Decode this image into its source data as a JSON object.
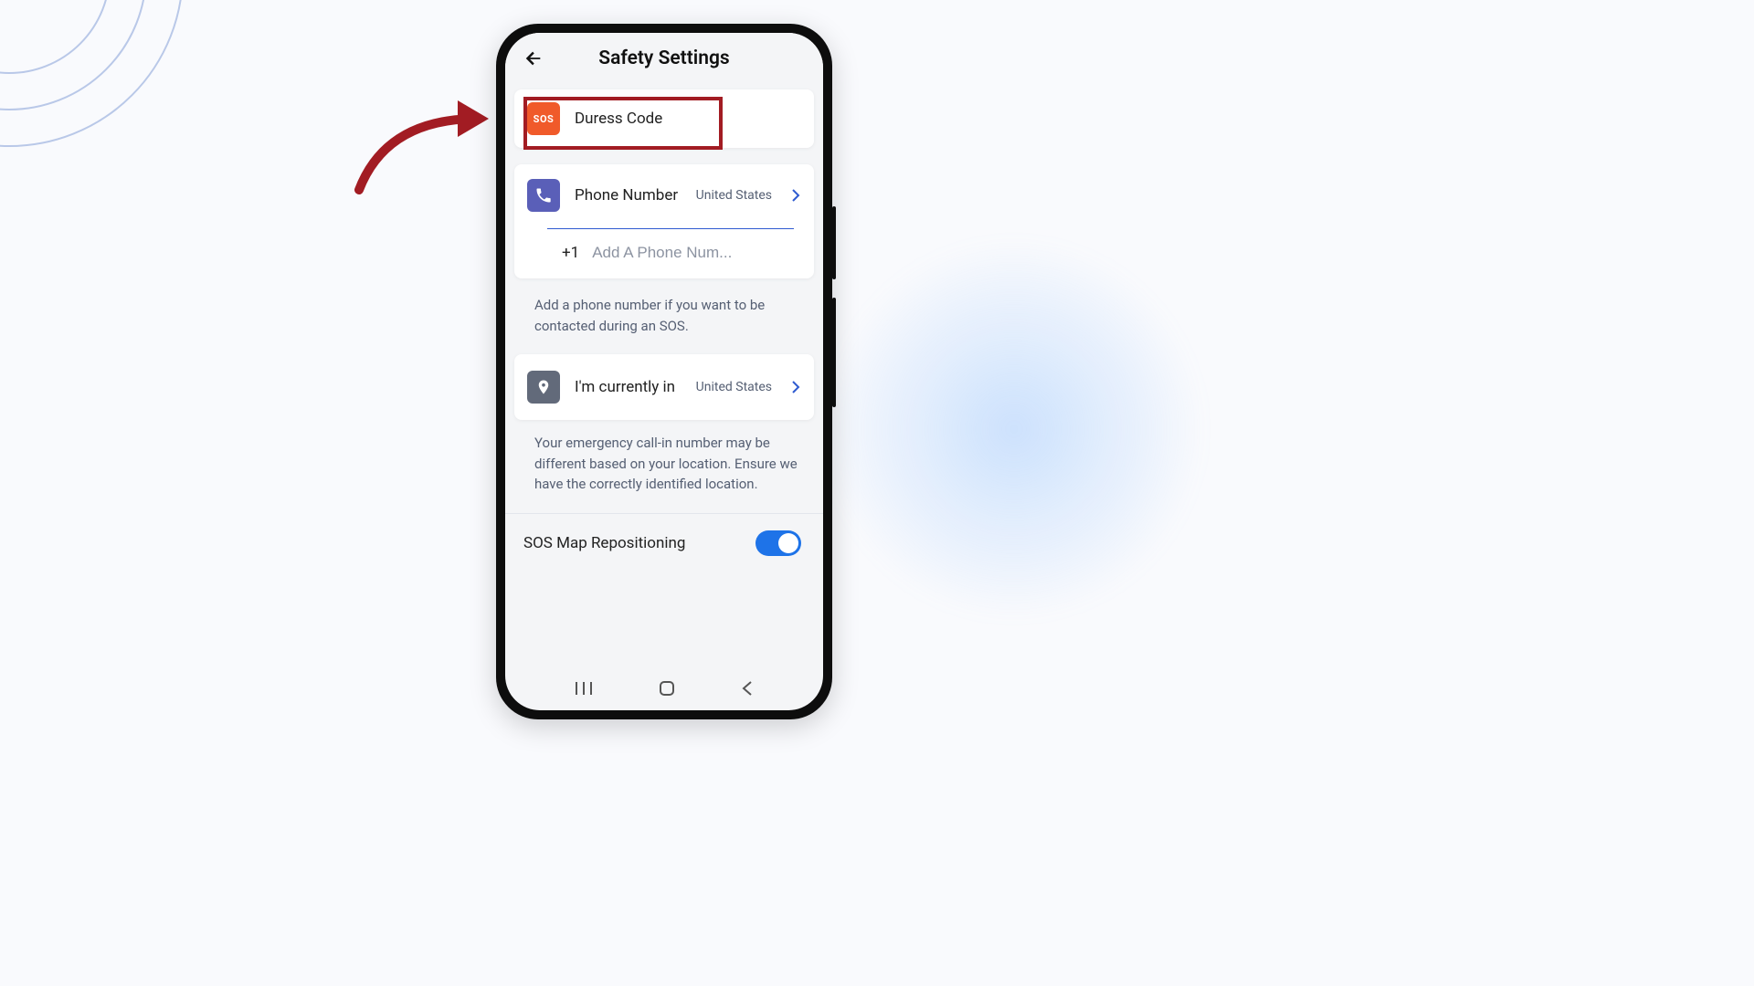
{
  "header": {
    "title": "Safety Settings"
  },
  "duress": {
    "icon_text": "SOS",
    "label": "Duress Code"
  },
  "phone": {
    "label": "Phone Number",
    "value": "United States",
    "prefix": "+1",
    "placeholder": "Add A Phone Num...",
    "helper": "Add a phone number if you want to be contacted during an SOS."
  },
  "location": {
    "label": "I'm currently in",
    "value": "United States",
    "helper": "Your emergency call-in number may be different based on your location. Ensure we have the correctly identified location."
  },
  "sos_map": {
    "label": "SOS Map Repositioning",
    "enabled": true
  }
}
